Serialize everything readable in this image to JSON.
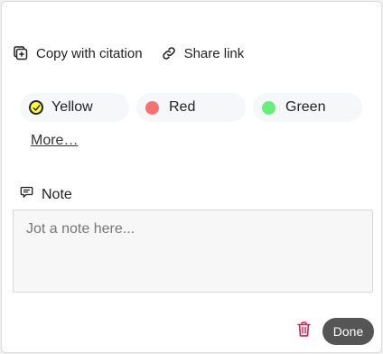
{
  "actions": {
    "copy_label": "Copy with citation",
    "share_label": "Share link"
  },
  "colors": {
    "options": [
      {
        "label": "Yellow",
        "color": "#ffff33",
        "selected": true
      },
      {
        "label": "Red",
        "color": "#f87171",
        "selected": false
      },
      {
        "label": "Green",
        "color": "#66f079",
        "selected": false
      }
    ],
    "more_label": "More…"
  },
  "note": {
    "heading": "Note",
    "placeholder": "Jot a note here...",
    "value": ""
  },
  "footer": {
    "done_label": "Done",
    "delete_icon_color": "#d61f4c"
  }
}
